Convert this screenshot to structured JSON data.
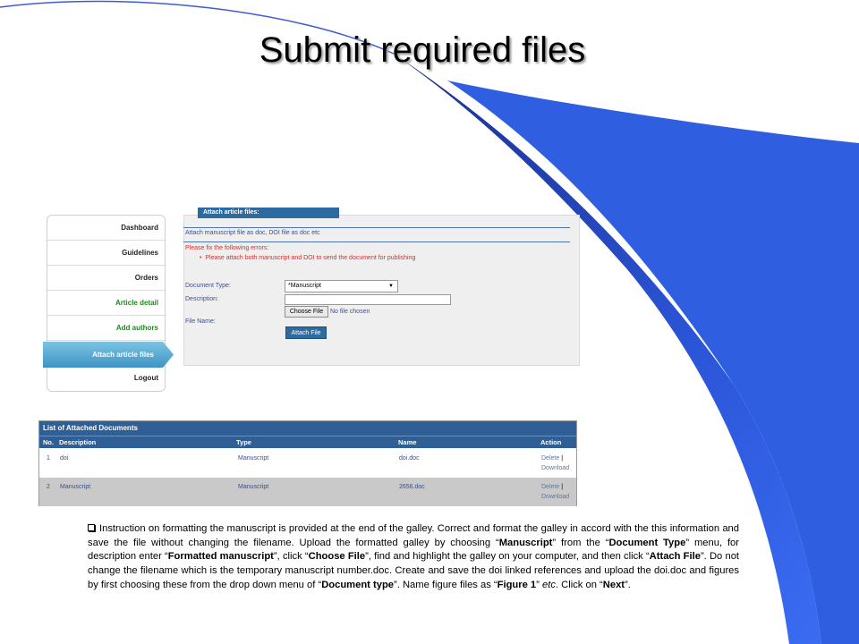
{
  "slide": {
    "title": "Submit required files"
  },
  "sidebar": {
    "items": [
      {
        "label": "Dashboard",
        "color": "#222222"
      },
      {
        "label": "Guidelines",
        "color": "#222222"
      },
      {
        "label": "Orders",
        "color": "#222222"
      },
      {
        "label": "Article detail",
        "color": "#1f8a1f"
      },
      {
        "label": "Add authors",
        "color": "#1f8a1f"
      },
      {
        "label": "Attach article files",
        "active": true
      },
      {
        "label": "Logout",
        "color": "#222222"
      }
    ]
  },
  "attach_panel": {
    "tab_label": "Attach article files:",
    "hint": "Attach manuscript file as doc, DOI file as doc etc",
    "error_heading": "Please fix the following errors:",
    "error_item": "Please attach both manuscript and DOI to send the document for publishing",
    "document_type_label": "Document Type:",
    "document_type_value": "*Manuscript",
    "description_label": "Description:",
    "description_value": "",
    "choose_file_label": "Choose File",
    "no_file_text": "No file chosen",
    "file_name_label": "File Name:",
    "attach_button": "Attach File"
  },
  "documents_table": {
    "title": "List of Attached Documents",
    "headers": [
      "No.",
      "Description",
      "Type",
      "Name",
      "Action"
    ],
    "rows": [
      {
        "no": "1",
        "description": "doi",
        "type": "Manuscript",
        "name": "doi.doc",
        "delete": "Delete",
        "sep": "|",
        "download": "Download"
      },
      {
        "no": "2",
        "description": "Manuscript",
        "type": "Manuscript",
        "name": "2656.doc",
        "delete": "Delete",
        "sep": "|",
        "download": "Download"
      }
    ]
  },
  "instructions": {
    "p1": "Instruction on formatting the manuscript is provided at the end of the galley. Correct and format the galley in accord with the this information and save the file without changing the filename. Upload the formatted galley by choosing “",
    "b1": "Manuscript",
    "p2": "” from the “",
    "b2": "Document Type",
    "p3": "” menu, for description enter “",
    "b3": "Formatted manuscript",
    "p4": "”, click “",
    "b4": "Choose File",
    "p5": "”, find and highlight the galley on your computer, and then click “",
    "b5": "Attach File",
    "p6": "”. Do not change the filename which is the temporary manuscript number.doc. Create and save the doi linked references and upload the doi.doc and figures by first choosing these from the drop down menu of “",
    "b6": "Document type",
    "p7": "”. Name figure files as “",
    "b7": "Figure 1",
    "p8": "” ",
    "i1": "etc",
    "p9": ". Click on “",
    "b8": "Next",
    "p10": "”."
  },
  "theme": {
    "accent": "#2f5f94",
    "error": "#d0312d",
    "deco_blue": "#2f5fe0"
  }
}
